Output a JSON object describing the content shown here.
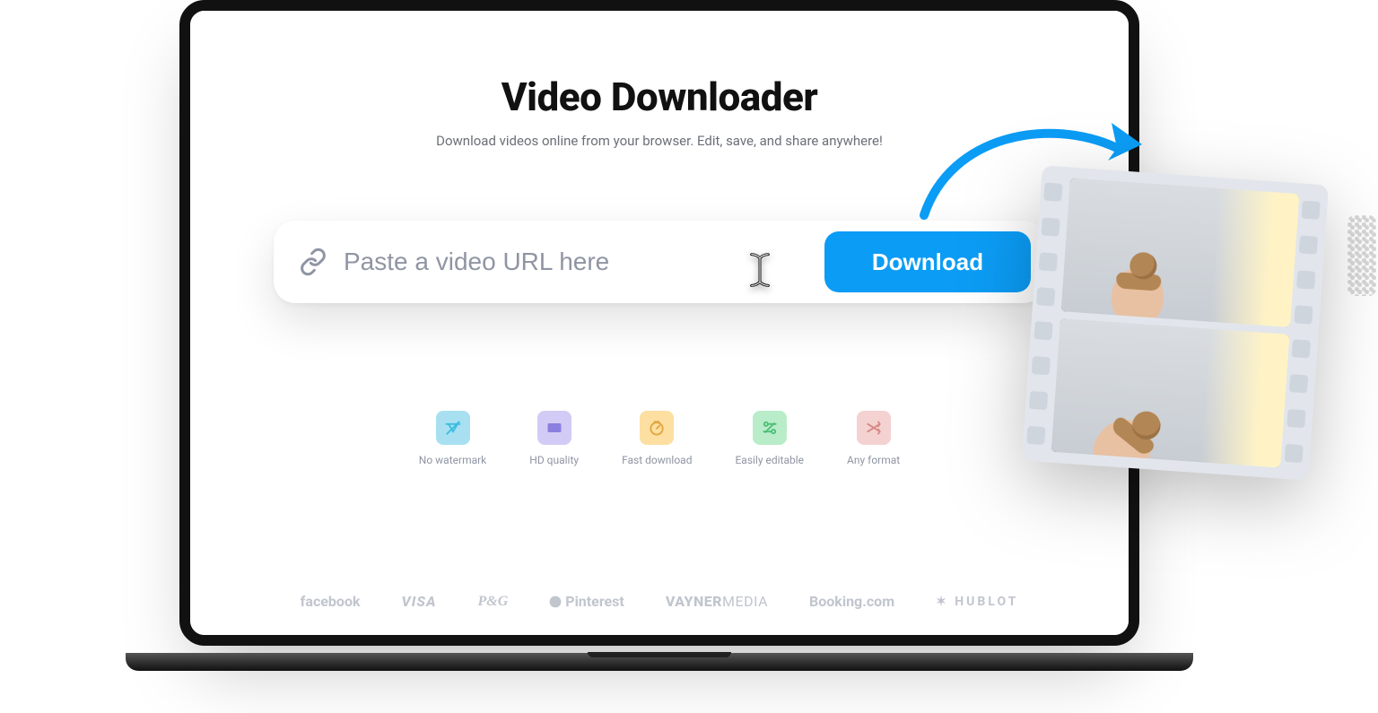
{
  "hero": {
    "title": "Video Downloader",
    "subtitle": "Download videos online from your browser. Edit, save, and share anywhere!"
  },
  "url_bar": {
    "placeholder": "Paste a video URL here",
    "value": "",
    "download_label": "Download"
  },
  "features": [
    {
      "icon": "no-watermark-icon",
      "label": "No watermark",
      "color": "blue"
    },
    {
      "icon": "hd-quality-icon",
      "label": "HD quality",
      "color": "purple"
    },
    {
      "icon": "fast-download-icon",
      "label": "Fast download",
      "color": "yellow"
    },
    {
      "icon": "easily-editable-icon",
      "label": "Easily editable",
      "color": "green"
    },
    {
      "icon": "any-format-icon",
      "label": "Any format",
      "color": "pink"
    }
  ],
  "brands": [
    "facebook",
    "VISA",
    "P&G",
    "Pinterest",
    "VAYNERMEDIA",
    "Booking.com",
    "HUBLOT"
  ],
  "colors": {
    "accent": "#0B9CF5",
    "muted": "#8f95a3",
    "brandGrey": "#C1C5CE"
  }
}
